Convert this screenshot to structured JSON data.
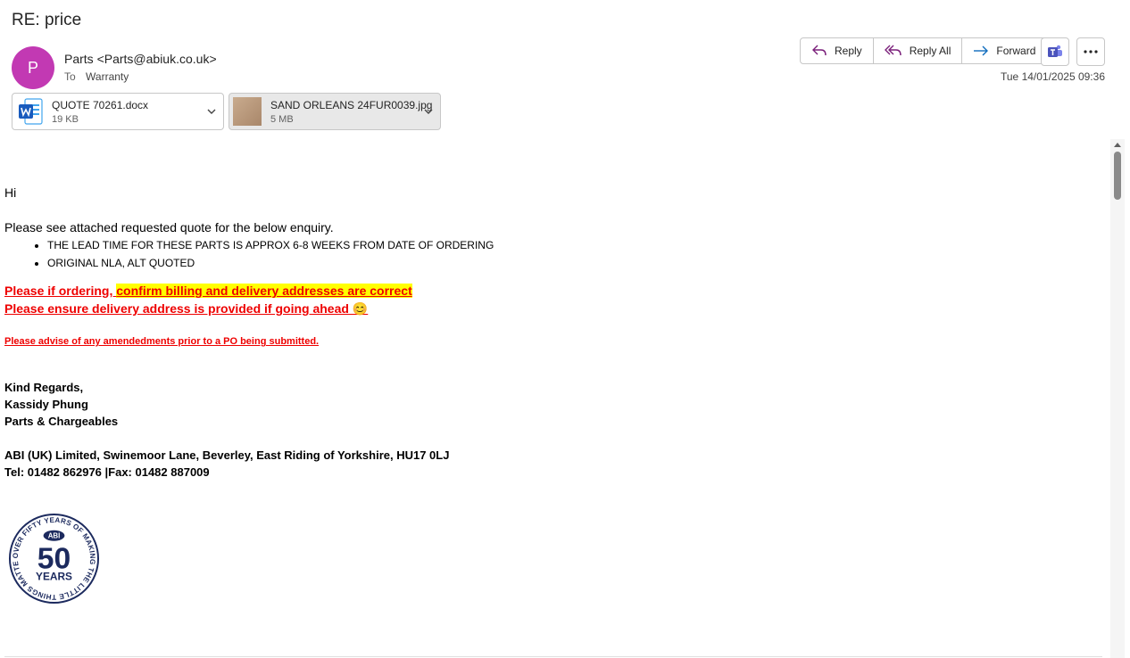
{
  "email": {
    "subject": "RE: price",
    "avatar_initial": "P",
    "sender": "Parts <Parts@abiuk.co.uk>",
    "to_label": "To",
    "to_value": "Warranty",
    "date": "Tue 14/01/2025 09:36",
    "accent_color": "#c239b3"
  },
  "actions": {
    "reply": "Reply",
    "reply_all": "Reply All",
    "forward": "Forward"
  },
  "attachments": [
    {
      "name": "QUOTE 70261.docx",
      "size": "19 KB",
      "icon": "word-icon"
    },
    {
      "name": "SAND ORLEANS 24FUR0039.jpg",
      "size": "5 MB",
      "icon": "image-thumbnail"
    }
  ],
  "body": {
    "greeting": "Hi",
    "intro": "Please see attached requested quote for the below enquiry.",
    "bullets": [
      "THE LEAD TIME FOR THESE PARTS IS APPROX 6-8 WEEKS FROM DATE OF ORDERING",
      "ORIGINAL NLA, ALT QUOTED"
    ],
    "warning1_plain": "Please if ordering, ",
    "warning1_highlight": "confirm billing and delivery addresses are correct",
    "warning2": "Please ensure delivery address is provided if going ahead 😊",
    "warning3": "Please advise of any amendedments prior to a PO being submitted.",
    "sig_line1": "Kind Regards,",
    "sig_line2": "Kassidy Phung",
    "sig_line3": "Parts & Chargeables",
    "address": "ABI (UK) Limited, Swinemoor Lane, Beverley, East Riding of Yorkshire, HU17 0LJ",
    "contact": "Tel: 01482 862976 |Fax: 01482 887009"
  },
  "logo": {
    "ring_text": "OVER FIFTY YEARS OF MAKING THE LITTLE THINGS MATTER",
    "brand": "ABI",
    "number": "50",
    "word": "YEARS",
    "color": "#1c2a5e"
  }
}
